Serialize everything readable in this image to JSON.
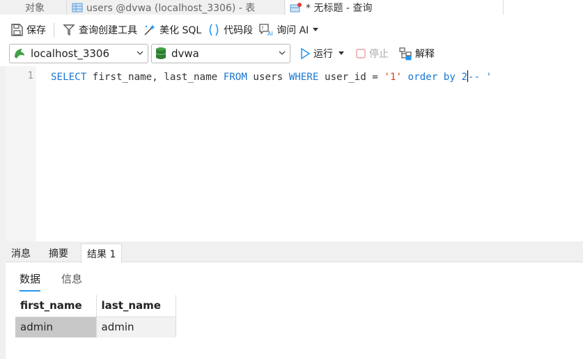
{
  "tabs": [
    {
      "label": "对象"
    },
    {
      "label": "users @dvwa (localhost_3306) - 表"
    },
    {
      "label": "* 无标题 - 查询"
    }
  ],
  "toolbar": {
    "save": "保存",
    "query_builder": "查询创建工具",
    "beautify": "美化 SQL",
    "code_snippet": "代码段",
    "ask_ai": "询问 AI"
  },
  "connection": {
    "selected": "localhost_3306"
  },
  "database": {
    "selected": "dvwa"
  },
  "actions": {
    "run": "运行",
    "stop": "停止",
    "explain": "解释"
  },
  "editor": {
    "line_number": "1",
    "tokens": {
      "select": "SELECT",
      "cols": " first_name, last_name ",
      "from": "FROM",
      "table": " users ",
      "where": "WHERE",
      "cond": " user_id = ",
      "str1": "'1'",
      "space": " ",
      "order_by": "order by",
      "space2": " ",
      "num": "2",
      "comment": "-- '"
    }
  },
  "bottom_tabs": {
    "messages": "消息",
    "summary": "摘要",
    "result": "结果 1"
  },
  "sub_tabs": {
    "data": "数据",
    "info": "信息"
  },
  "result": {
    "columns": [
      "first_name",
      "last_name"
    ],
    "rows": [
      [
        "admin",
        "admin"
      ]
    ]
  },
  "colors": {
    "keyword": "#1976d2",
    "string": "#d84315",
    "accent": "#2196f3"
  }
}
